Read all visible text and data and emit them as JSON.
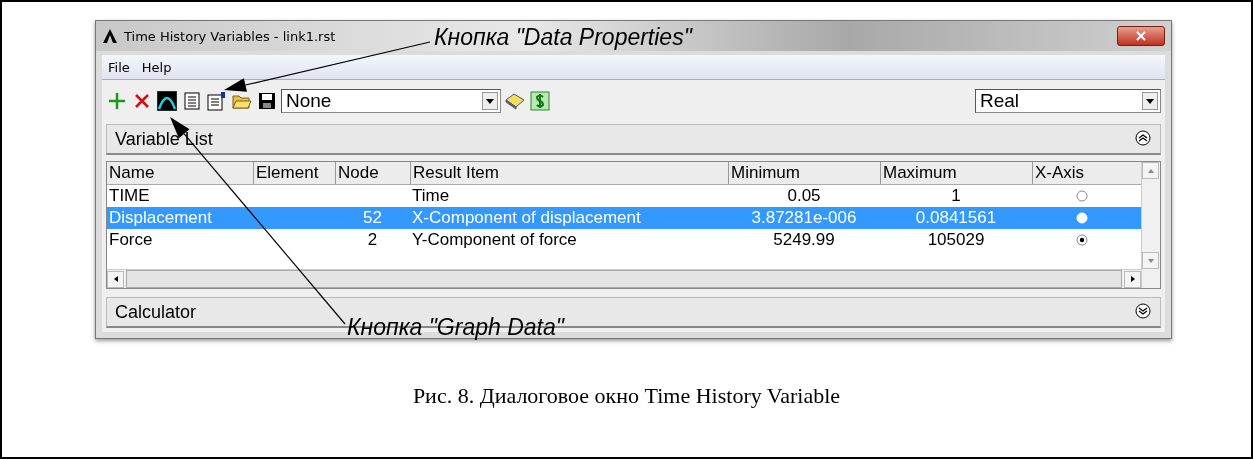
{
  "window": {
    "title": "Time History Variables - link1.rst"
  },
  "menu": [
    "File",
    "Help"
  ],
  "toolbar": {
    "variable_select": "None",
    "format_select": "Real"
  },
  "variable_list": {
    "header": "Variable List",
    "columns": [
      "Name",
      "Element",
      "Node",
      "Result Item",
      "Minimum",
      "Maximum",
      "X-Axis"
    ],
    "rows": [
      {
        "name": "TIME",
        "result_item": "Time",
        "minimum": "0.05",
        "maximum": "1",
        "x_axis": false,
        "selected": false
      },
      {
        "name": "Displacement",
        "node": "52",
        "result_item": "X-Component of displacement",
        "minimum": "3.87281e-006",
        "maximum": "0.0841561",
        "x_axis": false,
        "selected": true
      },
      {
        "name": "Force",
        "node": "2",
        "result_item": "Y-Component of force",
        "minimum": "5249.99",
        "maximum": "105029",
        "x_axis": true,
        "selected": false
      }
    ]
  },
  "calculator": {
    "header": "Calculator"
  },
  "annotations": [
    {
      "text": "Кнопка \"Data Properties\""
    },
    {
      "text": "Кнопка \"Graph Data\""
    }
  ],
  "caption": "Рис. 8. Диалоговое окно Time History Variable"
}
